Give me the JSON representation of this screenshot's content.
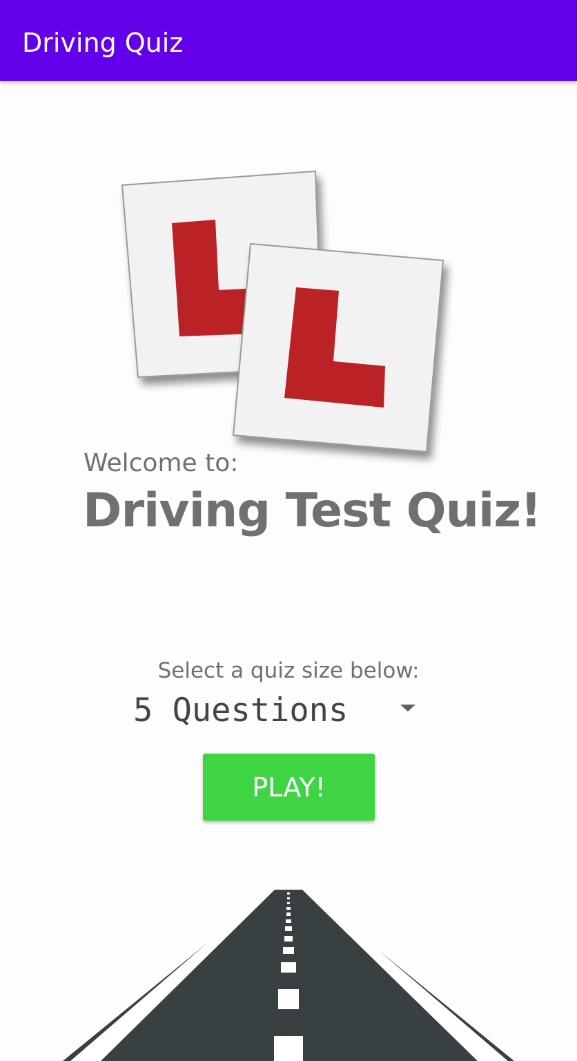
{
  "app_bar": {
    "title": "Driving Quiz",
    "color": "#6200ea"
  },
  "logo": {
    "icon": "learner-plates-icon",
    "plate_color": "#f2f2f2",
    "letter_color": "#bb2326"
  },
  "welcome": {
    "label": "Welcome to:",
    "title": "Driving Test Quiz!"
  },
  "quiz_size": {
    "label": "Select a quiz size below:",
    "selected": "5 Questions"
  },
  "play_button": {
    "label": "PLAY!",
    "color": "#3ed444"
  },
  "road": {
    "icon": "road-icon",
    "asphalt_color": "#394042"
  }
}
